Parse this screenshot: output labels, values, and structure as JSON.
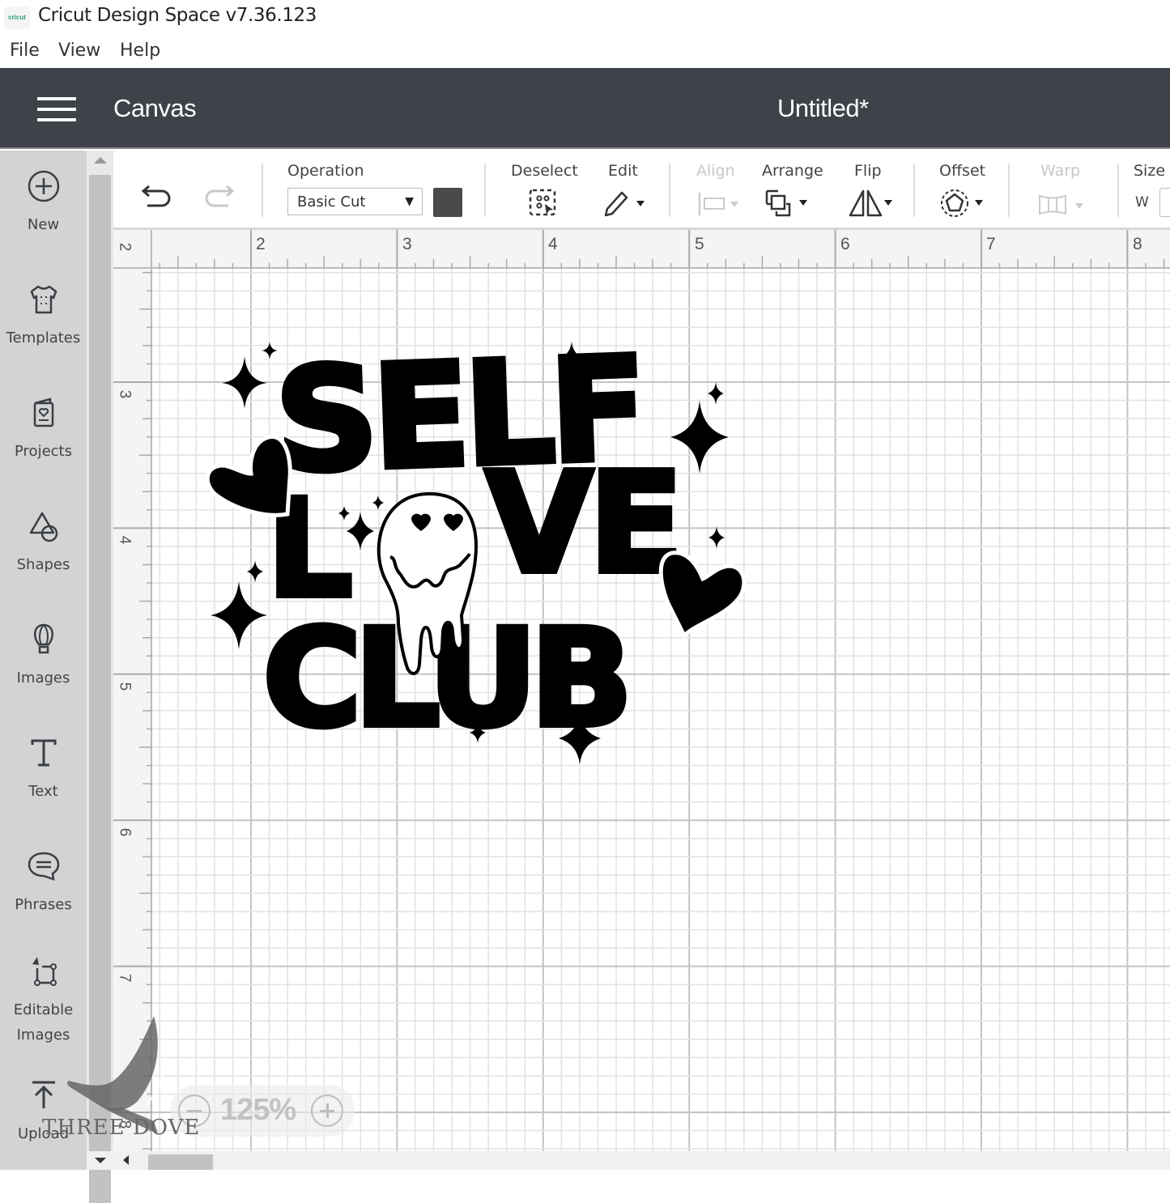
{
  "window": {
    "app_title": "Cricut Design Space  v7.36.123",
    "logo_text": "cricut"
  },
  "menubar": {
    "items": [
      {
        "label": "File"
      },
      {
        "label": "View"
      },
      {
        "label": "Help"
      }
    ]
  },
  "header": {
    "section": "Canvas",
    "document_title": "Untitled*"
  },
  "sidebar": {
    "items": [
      {
        "label": "New",
        "icon": "plus-circle-icon"
      },
      {
        "label": "Templates",
        "icon": "tshirt-icon"
      },
      {
        "label": "Projects",
        "icon": "project-card-icon"
      },
      {
        "label": "Shapes",
        "icon": "shapes-icon"
      },
      {
        "label": "Images",
        "icon": "hot-air-balloon-icon"
      },
      {
        "label": "Text",
        "icon": "text-icon"
      },
      {
        "label": "Phrases",
        "icon": "speech-bubble-icon"
      },
      {
        "label": "Editable Images",
        "label_line1": "Editable",
        "label_line2": "Images",
        "icon": "editable-image-icon"
      },
      {
        "label": "Upload",
        "icon": "upload-icon"
      }
    ]
  },
  "toolbar": {
    "undo": "undo",
    "redo": "redo",
    "operation_label": "Operation",
    "operation_value": "Basic Cut",
    "operation_color": "#4a4a4a",
    "deselect_label": "Deselect",
    "edit_label": "Edit",
    "align_label": "Align",
    "arrange_label": "Arrange",
    "flip_label": "Flip",
    "offset_label": "Offset",
    "warp_label": "Warp",
    "size_label": "Size",
    "size_w_label": "W"
  },
  "canvas": {
    "ruler_top": [
      "2",
      "3",
      "4",
      "5",
      "6",
      "7",
      "8"
    ],
    "ruler_left": [
      "2",
      "3",
      "4",
      "5",
      "6",
      "7",
      "8"
    ],
    "design": {
      "lines": [
        "SELF",
        "LOVE",
        "CLUB"
      ],
      "description": "Retro wavy text with melting smiley face as the O, hearts and sparkles"
    },
    "zoom_level": "125%"
  },
  "watermark": {
    "text": "THREE DOVE"
  }
}
